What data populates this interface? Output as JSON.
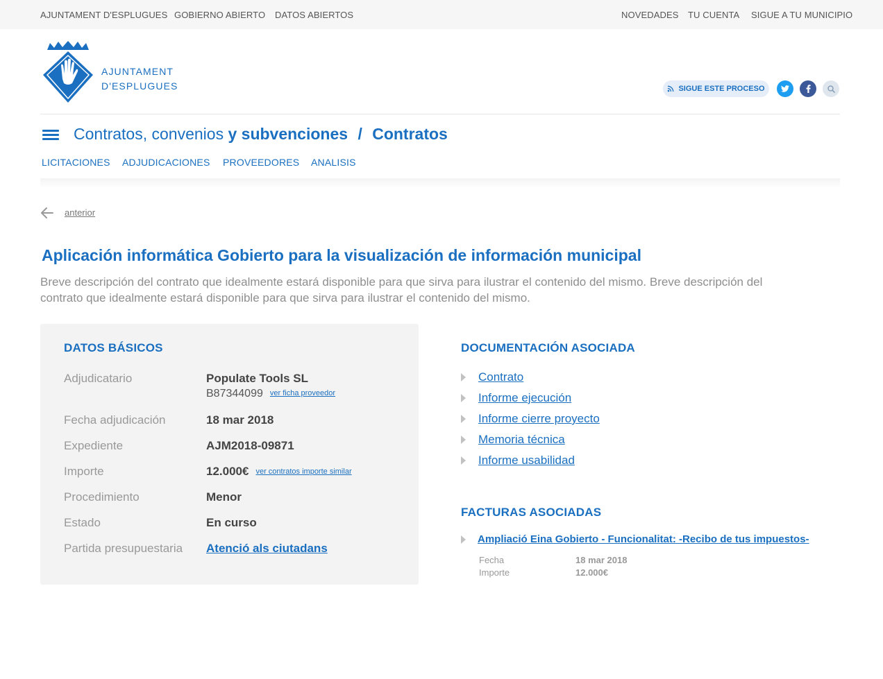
{
  "topbar": {
    "left_links": [
      "AJUNTAMENT D'ESPLUGUES",
      "GOBIERNO ABIERTO",
      "DATOS ABIERTOS"
    ],
    "right_links": [
      "NOVEDADES",
      "TU CUENTA",
      "SIGUE A TU MUNICIPIO"
    ]
  },
  "header": {
    "logo_line1": "AJUNTAMENT",
    "logo_line2": "D'ESPLUGUES",
    "follow_label": "SIGUE ESTE PROCESO",
    "brand_color": "#1a6fc0",
    "twitter_color": "#1d9ef0",
    "facebook_color": "#3b5998"
  },
  "titlebar": {
    "part1": "Contratos, convenios",
    "part2": "y subvenciones",
    "separator": "/",
    "part3": "Contratos"
  },
  "subnav": [
    "LICITACIONES",
    "ADJUDICACIONES",
    "PROVEEDORES",
    "ANALISIS"
  ],
  "back": {
    "label": "anterior"
  },
  "contract": {
    "title": "Aplicación informática Gobierto para la visualización de información municipal",
    "description": "Breve descripción del contrato que idealmente estará disponible para que sirva para ilustrar el contenido del mismo. Breve descripción del contrato que idealmente estará disponible para que sirva para ilustrar el contenido del mismo."
  },
  "basic": {
    "heading": "DATOS BÁSICOS",
    "adjudicatario_label": "Adjudicatario",
    "adjudicatario_value": "Populate Tools SL",
    "adjudicatario_cif": "B87344099",
    "adjudicatario_link": "ver ficha proveedor",
    "fecha_label": "Fecha adjudicación",
    "fecha_value": "18 mar 2018",
    "expediente_label": "Expediente",
    "expediente_value": "AJM2018-09871",
    "importe_label": "Importe",
    "importe_value": "12.000€",
    "importe_link": "ver contratos importe similar",
    "procedimiento_label": "Procedimiento",
    "procedimiento_value": "Menor",
    "estado_label": "Estado",
    "estado_value": "En curso",
    "partida_label": "Partida presupuestaria",
    "partida_value": "Atenció als ciutadans"
  },
  "docs": {
    "heading": "DOCUMENTACIÓN ASOCIADA",
    "items": [
      "Contrato",
      "Informe ejecución",
      "Informe cierre proyecto",
      "Memoria técnica",
      "Informe usabilidad"
    ]
  },
  "invoices": {
    "heading": "FACTURAS ASOCIADAS",
    "item_title": "Ampliació Eina Gobierto - Funcionalitat: -Recibo de tus impuestos-",
    "fecha_label": "Fecha",
    "fecha_value": "18 mar 2018",
    "importe_label": "Importe",
    "importe_value": "12.000€"
  }
}
